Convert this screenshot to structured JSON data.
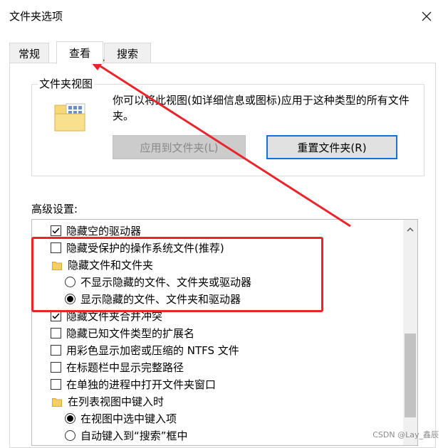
{
  "window": {
    "title": "文件夹选项"
  },
  "tabs": [
    {
      "label": "常规"
    },
    {
      "label": "查看"
    },
    {
      "label": "搜索"
    }
  ],
  "folder_view": {
    "legend": "文件夹视图",
    "description": "你可以将此视图(如详细信息或图标)应用于这种类型的所有文件夹。",
    "apply_label": "应用到文件夹(L)",
    "reset_label": "重置文件夹(R)"
  },
  "advanced": {
    "label": "高级设置:",
    "items": [
      {
        "type": "checkbox",
        "checked": true,
        "label": "隐藏空的驱动器"
      },
      {
        "type": "checkbox",
        "checked": false,
        "label": "隐藏受保护的操作系统文件(推荐)"
      },
      {
        "type": "folder",
        "label": "隐藏文件和文件夹"
      },
      {
        "type": "radio",
        "checked": false,
        "label": "不显示隐藏的文件、文件夹或驱动器"
      },
      {
        "type": "radio",
        "checked": true,
        "label": "显示隐藏的文件、文件夹和驱动器"
      },
      {
        "type": "checkbox",
        "checked": true,
        "label": "隐藏文件夹合并冲突"
      },
      {
        "type": "checkbox",
        "checked": false,
        "label": "隐藏已知文件类型的扩展名"
      },
      {
        "type": "checkbox",
        "checked": false,
        "label": "用彩色显示加密或压缩的 NTFS 文件"
      },
      {
        "type": "checkbox",
        "checked": false,
        "label": "在标题栏中显示完整路径"
      },
      {
        "type": "checkbox",
        "checked": false,
        "label": "在单独的进程中打开文件夹窗口"
      },
      {
        "type": "folder",
        "label": "在列表视图中键入时"
      },
      {
        "type": "radio",
        "checked": true,
        "label": "在视图中选中键入项"
      },
      {
        "type": "radio",
        "checked": false,
        "label": "自动键入到“搜索”框中"
      }
    ]
  },
  "watermark": "CSDN @Lay_鑫辰",
  "colors": {
    "annotation_red": "#e8252b",
    "focus_blue": "#1a6fd1"
  }
}
